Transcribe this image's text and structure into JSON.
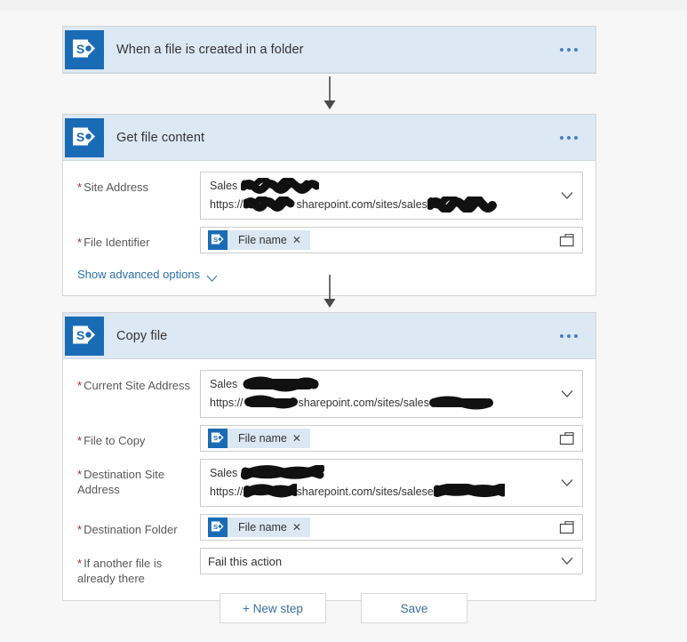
{
  "flow": {
    "steps": [
      {
        "id": "trigger",
        "title": "When a file is created in a folder",
        "icon": "sharepoint-icon",
        "menu_icon": "ellipsis-icon",
        "fields": []
      },
      {
        "id": "get-file-content",
        "title": "Get file content",
        "icon": "sharepoint-icon",
        "menu_icon": "ellipsis-icon",
        "advanced_label": "Show advanced options",
        "fields": [
          {
            "label": "Site Address",
            "required": "*",
            "type": "combo",
            "line1_prefix": "Sales",
            "line1_redacted": true,
            "line2_prefix": "https://",
            "line2_middle": "sharepoint.com/sites/sales",
            "line2_redacted": true
          },
          {
            "label": "File Identifier",
            "required": "*",
            "type": "token",
            "token_label": "File name",
            "token_icon": "sharepoint-icon",
            "token_remove_icon": "close-icon",
            "picker_icon": "folder-icon"
          }
        ]
      },
      {
        "id": "copy-file",
        "title": "Copy file",
        "icon": "sharepoint-icon",
        "menu_icon": "ellipsis-icon",
        "fields": [
          {
            "label": "Current Site Address",
            "required": "*",
            "type": "combo",
            "line1_prefix": "Sales",
            "line1_redacted": true,
            "line2_prefix": "https://",
            "line2_middle": "sharepoint.com/sites/sales",
            "line2_redacted": true
          },
          {
            "label": "File to Copy",
            "required": "*",
            "type": "token",
            "token_label": "File name",
            "token_icon": "sharepoint-icon",
            "token_remove_icon": "close-icon",
            "picker_icon": "folder-icon"
          },
          {
            "label": "Destination Site Address",
            "required": "*",
            "type": "combo",
            "line1_prefix": "Sales",
            "line1_redacted": true,
            "line2_prefix": "https://",
            "line2_middle": "sharepoint.com/sites/salese",
            "line2_redacted": true
          },
          {
            "label": "Destination Folder",
            "required": "*",
            "type": "token",
            "token_label": "File name",
            "token_icon": "sharepoint-icon",
            "token_remove_icon": "close-icon",
            "picker_icon": "folder-icon"
          },
          {
            "label": "If another file is already there",
            "required": "*",
            "type": "select",
            "value": "Fail this action",
            "chevron_icon": "chevron-down-icon"
          }
        ]
      }
    ],
    "connector_icon": "arrow-down-icon"
  },
  "actions": {
    "new_step_label": "+ New step",
    "save_label": "Save"
  },
  "colors": {
    "accent": "#1a6bb5",
    "header_bg": "#dce8f4",
    "link": "#2a6fad",
    "required": "#a4262c",
    "page_bg": "#f7f7f7"
  }
}
